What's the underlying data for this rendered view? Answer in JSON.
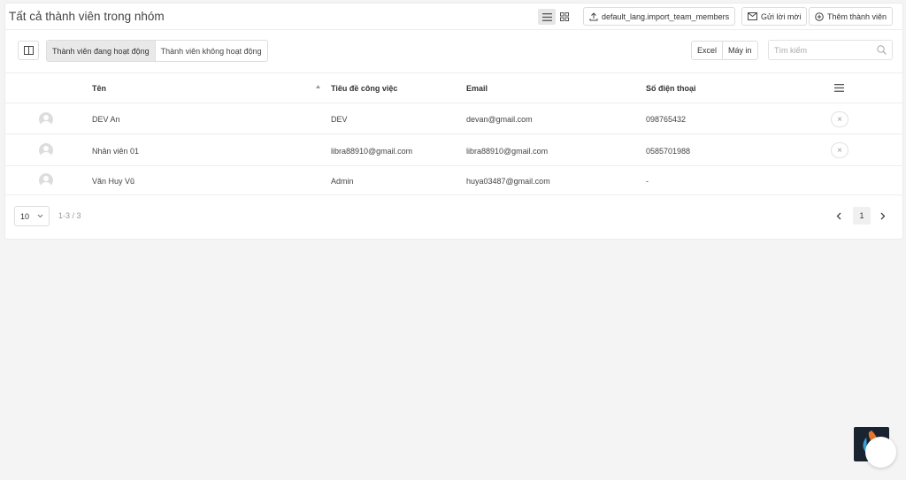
{
  "header": {
    "title": "Tất cả thành viên trong nhóm",
    "import_label": "default_lang.import_team_members",
    "invite_label": "Gửi lời mời",
    "add_label": "Thêm thành viên"
  },
  "toolbar": {
    "tabs": [
      {
        "label": "Thành viên đang hoạt động",
        "active": true
      },
      {
        "label": "Thành viên không hoạt động",
        "active": false
      }
    ],
    "excel_label": "Excel",
    "print_label": "Máy in",
    "search_placeholder": "Tìm kiếm"
  },
  "table": {
    "columns": [
      "Tên",
      "Tiêu đề công việc",
      "Email",
      "Số điện thoại"
    ],
    "rows": [
      {
        "name": "DEV An",
        "title": "DEV",
        "email": "devan@gmail.com",
        "phone": "098765432",
        "removable": true
      },
      {
        "name": "Nhân viên 01",
        "title": "libra88910@gmail.com",
        "email": "libra88910@gmail.com",
        "phone": "0585701988",
        "removable": true
      },
      {
        "name": "Văn Huy Vũ",
        "title": "Admin",
        "email": "huya03487@gmail.com",
        "phone": "-",
        "removable": false
      }
    ]
  },
  "footer": {
    "page_size": "10",
    "range": "1-3 / 3",
    "current_page": "1"
  },
  "colors": {
    "accent": "#e6e6e6",
    "border": "#dddddd",
    "background": "#f4f4f5"
  }
}
